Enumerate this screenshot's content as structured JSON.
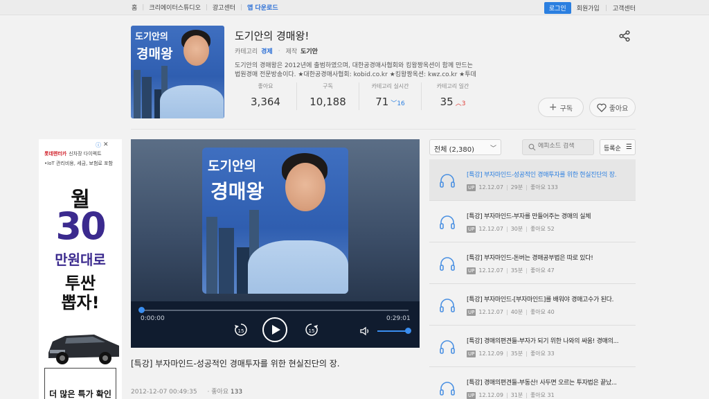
{
  "topnav": {
    "left": [
      "홈",
      "크리에이터스튜디오",
      "광고센터",
      "앱 다운로드"
    ],
    "login": "로그인",
    "right": [
      "회원가입",
      "고객센터"
    ]
  },
  "podcast": {
    "cover_line1": "도기안의",
    "cover_line2": "경매왕",
    "title": "도기안의 경매왕!",
    "category_label": "카테고리",
    "category": "경제",
    "producer_label": "제작",
    "producer": "도기안",
    "description_1": "도기안의 경매왕은 2012년에 출범하였으며, 대한공경매사협회와 킹왕짱옥션이 함께 만드는",
    "description_2": "법원경매 전문방송이다. ★대한공경매사협회: kobid.co.kr ★킹왕짱옥션: kwz.co.kr ★투데"
  },
  "stats": [
    {
      "label": "좋아요",
      "value": "3,364",
      "delta": "",
      "dir": ""
    },
    {
      "label": "구독",
      "value": "10,188",
      "delta": "",
      "dir": ""
    },
    {
      "label": "카테고리 실시간",
      "value": "71",
      "delta": "16",
      "dir": "down"
    },
    {
      "label": "카테고리 일간",
      "value": "35",
      "delta": "3",
      "dir": "up"
    }
  ],
  "buttons": {
    "subscribe": "구독",
    "like": "좋아요"
  },
  "ad": {
    "brand": "롯데렌터카",
    "brand_sub": "신차장 다이렉트",
    "sub": "•IoT 관리비용, 세금, 보험료 포함",
    "line1": "월",
    "line2": "30",
    "line3": "만원대로",
    "line4": "투싼",
    "line5": "뽑자!",
    "cta": "더 많은 특가 확인"
  },
  "player": {
    "current_time": "0:00:00",
    "total_time": "0:29:01",
    "rewind": "15",
    "forward": "15",
    "progress": 0.0,
    "volume": 1.0
  },
  "episode": {
    "title": "[특강] 부자마인드-성공적인 경매투자를 위한 현실진단의 장.",
    "datetime": "2012-12-07 00:49:35",
    "likes_label": "좋아요",
    "likes": "133"
  },
  "list_controls": {
    "filter": "전체 (2,380)",
    "search_placeholder": "에피소드 검색",
    "sort": "등록순"
  },
  "episodes": [
    {
      "title": "[특강] 부자마인드-성공적인 경매투자를 위한 현실진단의 장.",
      "badge": "UP",
      "date": "12.12.07",
      "duration": "29분",
      "likes": "좋아요 133"
    },
    {
      "title": "[특강] 부자마인드-부자를 만들어주는 경매의 실체",
      "badge": "UP",
      "date": "12.12.07",
      "duration": "30분",
      "likes": "좋아요 52"
    },
    {
      "title": "[특강] 부자마인드-돈버는 경매공부법은 따로 있다!",
      "badge": "UP",
      "date": "12.12.07",
      "duration": "35분",
      "likes": "좋아요 47"
    },
    {
      "title": "[특강] 부자마인드-[부자마인드]를 배워야 경매고수가 된다.",
      "badge": "UP",
      "date": "12.12.07",
      "duration": "40분",
      "likes": "좋아요 40"
    },
    {
      "title": "[특강] 경매의편견들-부자가 되기 위한 나와의 싸움! 경매의...",
      "badge": "UP",
      "date": "12.12.09",
      "duration": "35분",
      "likes": "좋아요 33"
    },
    {
      "title": "[특강] 경매의편견들-부동산! 사두면 오르는 투자법은 끝났...",
      "badge": "UP",
      "date": "12.12.09",
      "duration": "31분",
      "likes": "좋아요 31"
    }
  ]
}
